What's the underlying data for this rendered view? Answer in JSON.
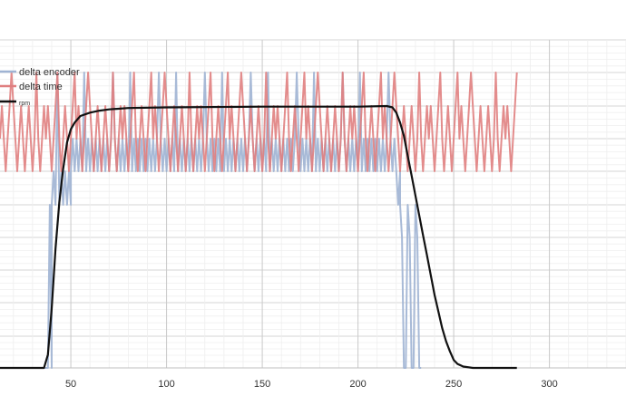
{
  "chart_data": {
    "type": "line",
    "title": "",
    "xlabel": "",
    "ylabel": "",
    "xlim": [
      13,
      340
    ],
    "x_ticks": [
      50,
      100,
      150,
      200,
      250,
      300
    ],
    "x_minor_step": 10,
    "grid": true,
    "legend_position": "top-left",
    "series": [
      {
        "name": "delta encoder",
        "color": "#9fb3d3",
        "stroke_width": 2,
        "segments": [
          {
            "x_start": 13,
            "x_end": 38,
            "pattern": [
              0
            ]
          },
          {
            "x_start": 38,
            "x_end": 40,
            "pattern": [
              0,
              2
            ]
          },
          {
            "x_start": 40,
            "x_end": 50,
            "pattern": [
              2,
              3,
              2,
              6,
              2,
              3,
              2,
              3,
              2,
              3,
              2
            ]
          },
          {
            "x_start": 50,
            "x_end": 220,
            "pattern": [
              3,
              4,
              3,
              4,
              3,
              4,
              3,
              7,
              3,
              4,
              3,
              4,
              3,
              4,
              3,
              4,
              3,
              4,
              3,
              4,
              3,
              4,
              7,
              4
            ]
          },
          {
            "x_start": 220,
            "x_end": 222,
            "pattern": [
              3,
              2
            ]
          },
          {
            "x_start": 222,
            "x_end": 233,
            "pattern": [
              2,
              1,
              0,
              0
            ]
          }
        ]
      },
      {
        "name": "delta time",
        "color": "#e07f80",
        "stroke_width": 2,
        "segments": [
          {
            "x_start": 13,
            "x_end": 283,
            "pattern": [
              4,
              5,
              4,
              3,
              4,
              5,
              6,
              5,
              4,
              3,
              4,
              5,
              4,
              3,
              4,
              5,
              4,
              3,
              4,
              6,
              4,
              3,
              4,
              5,
              4,
              5,
              4,
              3,
              4,
              5,
              6,
              4,
              3,
              4,
              5,
              4,
              3,
              4,
              5,
              6
            ]
          }
        ]
      },
      {
        "name": "rpm",
        "color": "#111111",
        "stroke_width": 2.2,
        "points": [
          [
            13,
            0
          ],
          [
            36,
            0
          ],
          [
            38,
            20
          ],
          [
            40,
            90
          ],
          [
            42,
            180
          ],
          [
            44,
            250
          ],
          [
            46,
            300
          ],
          [
            48,
            340
          ],
          [
            50,
            360
          ],
          [
            52,
            370
          ],
          [
            55,
            380
          ],
          [
            60,
            385
          ],
          [
            65,
            388
          ],
          [
            70,
            390
          ],
          [
            80,
            392
          ],
          [
            100,
            393
          ],
          [
            150,
            394
          ],
          [
            200,
            394
          ],
          [
            215,
            395
          ],
          [
            218,
            393
          ],
          [
            220,
            385
          ],
          [
            222,
            370
          ],
          [
            224,
            350
          ],
          [
            226,
            320
          ],
          [
            228,
            290
          ],
          [
            230,
            260
          ],
          [
            232,
            230
          ],
          [
            234,
            200
          ],
          [
            236,
            170
          ],
          [
            238,
            140
          ],
          [
            240,
            110
          ],
          [
            242,
            85
          ],
          [
            244,
            60
          ],
          [
            246,
            40
          ],
          [
            248,
            25
          ],
          [
            250,
            12
          ],
          [
            252,
            6
          ],
          [
            255,
            2
          ],
          [
            260,
            0
          ],
          [
            283,
            0
          ]
        ]
      }
    ],
    "y_scale_note": "series share one chart area; delta series are integer counts, rpm is a continuous curve"
  }
}
